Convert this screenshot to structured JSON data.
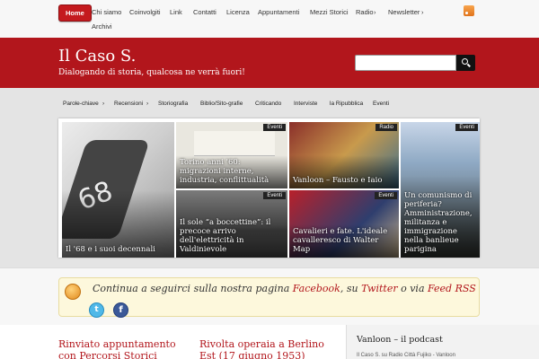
{
  "topnav": {
    "home": "Home",
    "items": [
      "Chi siamo",
      "Coinvolgiti",
      "Link",
      "Contatti",
      "Licenza",
      "Appuntamenti",
      "Mezzi Storici",
      "Radio",
      "Newsletter",
      "Archivi"
    ]
  },
  "header": {
    "title": "Il Caso S.",
    "tagline": "Dialogando di storia, qualcosa ne verrà fuori!",
    "search_placeholder": ""
  },
  "subnav": {
    "items": [
      "Parole-chiave",
      "Recensioni",
      "Storiografia",
      "Biblio/Sito-grafie",
      "Criticando",
      "Interviste",
      "la Ripubblica",
      "Eventi"
    ]
  },
  "slider": [
    {
      "category": "",
      "caption": "Il '68 e i suoi decennali"
    },
    {
      "category": "Eventi",
      "caption": "Torino anni '60: migrazioni interne, industria, conflittualità"
    },
    {
      "category": "Radio",
      "caption": "Vanloon – Fausto e Iaio"
    },
    {
      "category": "Eventi",
      "caption": "Un comunismo di periferia? Amministrazione, militanza e immigrazione nella banlieue parigina"
    },
    {
      "category": "Eventi",
      "caption": "Il sole “a boccettine”: il precoce arrivo dell'elettricità in Valdinievole"
    },
    {
      "category": "Eventi",
      "caption": "Cavalieri e fate. L'ideale cavalleresco di Walter Map"
    }
  ],
  "callout": {
    "prefix": "Continua a seguirci sulla nostra pagina ",
    "facebook": "Facebook",
    "mid": ", su ",
    "twitter": "Twitter",
    "or": " o via ",
    "rss": "Feed RSS"
  },
  "posts": [
    "Rinviato appuntamento con Percorsi Storici",
    "Rivolta operaia a Berlino Est (17 giugno 1953)"
  ],
  "sidebar": {
    "title": "Vanloon – il podcast",
    "sub": "Il Caso S. su Radio Città Fujiko - Vanloon"
  },
  "colors": {
    "accent": "#b2161c",
    "home_button": "#c41a1e"
  },
  "icons": [
    "rss-icon",
    "search-icon",
    "twitter-icon",
    "facebook-icon"
  ]
}
